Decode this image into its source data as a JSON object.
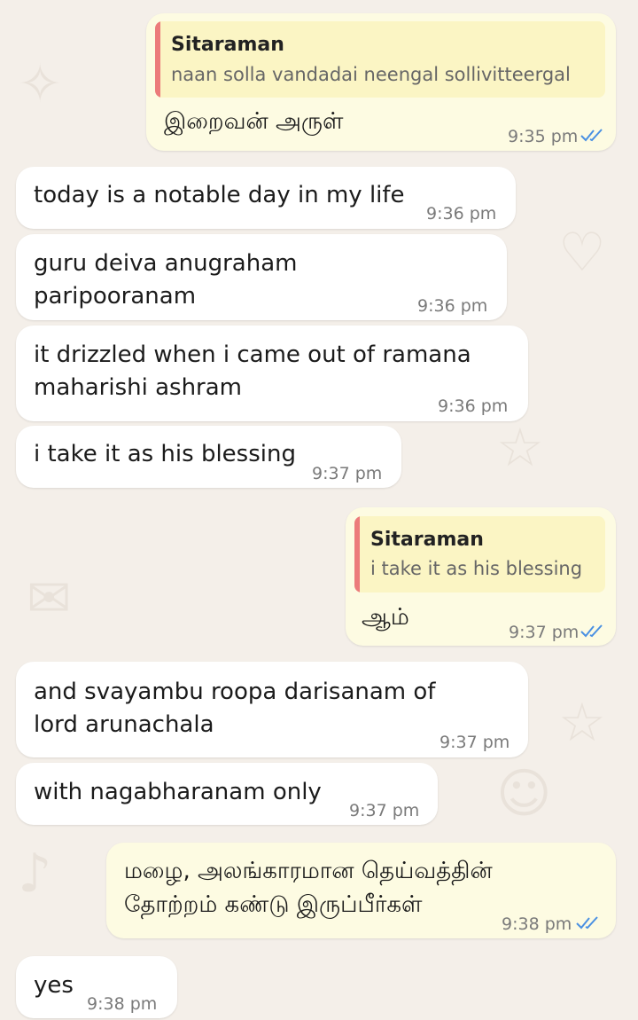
{
  "colors": {
    "background": "#f4efe9",
    "incoming_bubble": "#ffffff",
    "outgoing_bubble": "#fdfbe2",
    "quote_background": "#fbf5c4",
    "quote_bar": "#ec7b7b",
    "read_ticks": "#4a90e2"
  },
  "messages": [
    {
      "direction": "outgoing",
      "quote": {
        "name": "Sitaraman",
        "text": "naan solla vandadai neengal sollivitteergal"
      },
      "text": "இறைவன் அருள்",
      "time": "9:35 pm",
      "status_icon": "double-check-icon"
    },
    {
      "direction": "incoming",
      "text": "today is a notable day in my life",
      "time": "9:36 pm"
    },
    {
      "direction": "incoming",
      "text_lines": [
        "guru deiva anugraham",
        "paripooranam"
      ],
      "time": "9:36 pm"
    },
    {
      "direction": "incoming",
      "text_lines": [
        "it drizzled when i came out of ramana",
        "maharishi ashram"
      ],
      "time": "9:36 pm"
    },
    {
      "direction": "incoming",
      "text": "i take it as his blessing",
      "time": "9:37 pm"
    },
    {
      "direction": "outgoing",
      "quote": {
        "name": "Sitaraman",
        "text": "i take it as his blessing"
      },
      "text": "ஆம்",
      "time": "9:37 pm",
      "status_icon": "double-check-icon"
    },
    {
      "direction": "incoming",
      "text_lines": [
        "and svayambu roopa darisanam of",
        "lord arunachala"
      ],
      "time": "9:37 pm"
    },
    {
      "direction": "incoming",
      "text": "with nagabharanam only",
      "time": "9:37 pm"
    },
    {
      "direction": "outgoing",
      "text_lines": [
        "மழை, அலங்காரமான தெய்வத்தின்",
        "தோற்றம் கண்டு இருப்பீர்கள்"
      ],
      "time": "9:38 pm",
      "status_icon": "double-check-icon"
    },
    {
      "direction": "incoming",
      "text": "yes",
      "time": "9:38 pm"
    }
  ]
}
